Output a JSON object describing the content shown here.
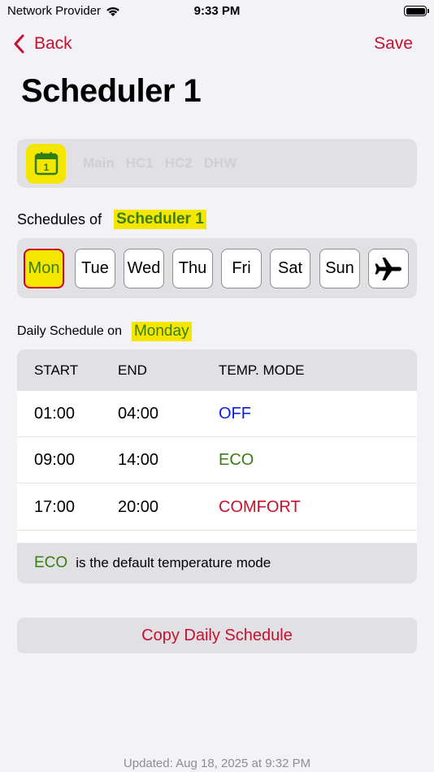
{
  "status_bar": {
    "carrier": "Network Provider",
    "time": "9:33 PM"
  },
  "nav": {
    "back_label": "Back",
    "save_label": "Save"
  },
  "title": "Scheduler 1",
  "circuit_selector": {
    "calendar_number": "1",
    "items": [
      "Main",
      "HC1",
      "HC2",
      "DHW"
    ]
  },
  "schedules": {
    "label": "Schedules of",
    "name": "Scheduler 1"
  },
  "days": {
    "items": [
      "Mon",
      "Tue",
      "Wed",
      "Thu",
      "Fri",
      "Sat",
      "Sun"
    ],
    "selected": "Mon",
    "vacation_icon": "airplane-icon"
  },
  "daily": {
    "label": "Daily Schedule on",
    "day": "Monday"
  },
  "table": {
    "columns": [
      "START",
      "END",
      "TEMP. MODE"
    ],
    "rows": [
      {
        "start": "01:00",
        "end": "04:00",
        "mode": "OFF",
        "mode_color": "#0a1ee6"
      },
      {
        "start": "09:00",
        "end": "14:00",
        "mode": "ECO",
        "mode_color": "#3a7d11"
      },
      {
        "start": "17:00",
        "end": "20:00",
        "mode": "COMFORT",
        "mode_color": "#c8102e"
      }
    ],
    "footer": {
      "mode": "ECO",
      "text": "is the default temperature mode"
    }
  },
  "copy_button": "Copy Daily Schedule",
  "updated": "Updated: Aug 18, 2025 at 9:32 PM",
  "colors": {
    "accent": "#c8102e",
    "highlight": "#f5e600",
    "eco": "#3a7d11",
    "off": "#0a1ee6"
  }
}
